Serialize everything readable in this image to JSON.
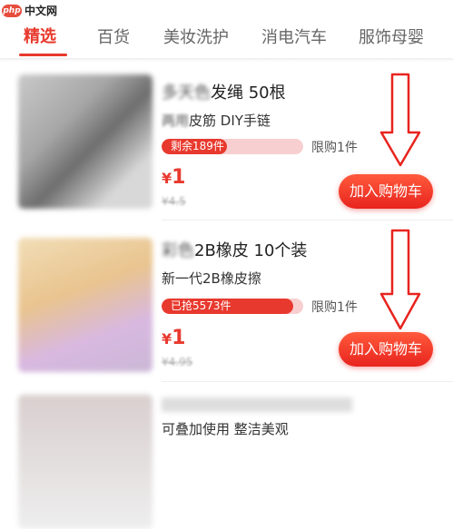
{
  "watermark": {
    "logo": "php",
    "text": "中文网"
  },
  "tabs": [
    {
      "label": "精选",
      "active": true
    },
    {
      "label": "百货"
    },
    {
      "label": "美妆洗护"
    },
    {
      "label": "消电汽车"
    },
    {
      "label": "服饰母婴"
    }
  ],
  "items": [
    {
      "title_blurred": "多天色",
      "title": "发绳 50根",
      "subtitle_blurred": "两用",
      "subtitle": "皮筋 DIY手链",
      "progress_label": "剩余189件",
      "progress_fraction": 0.46,
      "limit": "限购1件",
      "price_symbol": "¥",
      "price": "1",
      "original_price": "¥4.5",
      "button": "加入购物车"
    },
    {
      "title_blurred": "彩色",
      "title": "2B橡皮 10个装",
      "subtitle": "新一代2B橡皮擦",
      "progress_label": "已抢5573件",
      "progress_fraction": 0.93,
      "limit": "限购1件",
      "price_symbol": "¥",
      "price": "1",
      "original_price": "¥4.95",
      "button": "加入购物车"
    },
    {
      "subtitle": "可叠加使用 整洁美观"
    }
  ],
  "colors": {
    "accent": "#e8392e",
    "progress_bg": "#f8cfd0",
    "arrow": "#e8241e"
  }
}
